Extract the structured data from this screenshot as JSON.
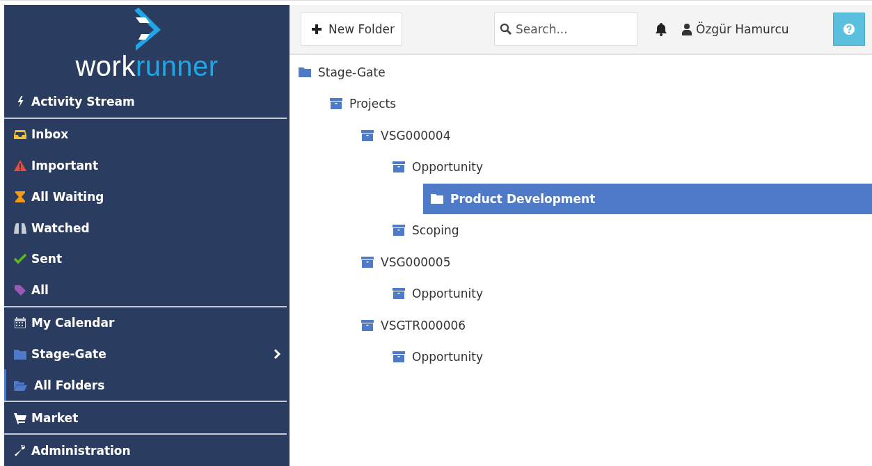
{
  "logo": {
    "parts": [
      "work",
      "runner"
    ]
  },
  "sidebar": {
    "sections": [
      [
        {
          "label": "Activity Stream",
          "kind": "bolt",
          "selected": false,
          "expandable": false
        }
      ],
      [
        {
          "label": "Inbox",
          "kind": "inbox",
          "selected": false,
          "expandable": false
        },
        {
          "label": "Important",
          "kind": "warning",
          "selected": false,
          "expandable": false
        },
        {
          "label": "All Waiting",
          "kind": "hourglass",
          "selected": false,
          "expandable": false
        },
        {
          "label": "Watched",
          "kind": "binoculars",
          "selected": false,
          "expandable": false
        },
        {
          "label": "Sent",
          "kind": "check",
          "selected": false,
          "expandable": false
        },
        {
          "label": "All",
          "kind": "tag",
          "selected": false,
          "expandable": false
        }
      ],
      [
        {
          "label": "My Calendar",
          "kind": "calendar",
          "selected": false,
          "expandable": false
        },
        {
          "label": "Stage-Gate",
          "kind": "folder",
          "selected": false,
          "expandable": true
        },
        {
          "label": "All Folders",
          "kind": "folder-open",
          "selected": true,
          "expandable": false
        }
      ],
      [
        {
          "label": "Market",
          "kind": "cart",
          "selected": false,
          "expandable": false
        }
      ],
      [
        {
          "label": "Administration",
          "kind": "wrench",
          "selected": false,
          "expandable": false
        }
      ]
    ]
  },
  "toolbar": {
    "new_button": "New Folder",
    "search": {
      "placeholder": "Search..."
    },
    "user": "Özgür Hamurcu"
  },
  "tree": [
    {
      "label": "Stage-Gate",
      "kind": "folder",
      "selected": false,
      "children": [
        {
          "label": "Projects",
          "kind": "archive",
          "selected": false,
          "children": [
            {
              "label": "VSG000004",
              "kind": "archive",
              "selected": false,
              "children": [
                {
                  "label": "Opportunity",
                  "kind": "archive",
                  "selected": false,
                  "children": [
                    {
                      "label": "Product Development",
                      "kind": "folder",
                      "selected": true
                    }
                  ]
                },
                {
                  "label": "Scoping",
                  "kind": "archive",
                  "selected": false
                }
              ]
            },
            {
              "label": "VSG000005",
              "kind": "archive",
              "selected": false,
              "children": [
                {
                  "label": "Opportunity",
                  "kind": "archive",
                  "selected": false
                }
              ]
            },
            {
              "label": "VSGTR000006",
              "kind": "archive",
              "selected": false,
              "children": [
                {
                  "label": "Opportunity",
                  "kind": "archive",
                  "selected": false
                }
              ]
            }
          ]
        }
      ]
    }
  ]
}
